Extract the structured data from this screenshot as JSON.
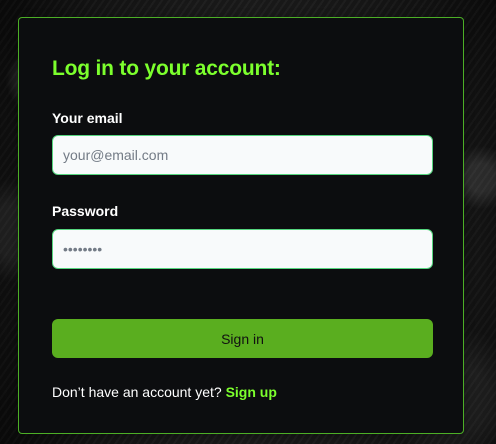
{
  "form": {
    "title": "Log in to your account:",
    "email": {
      "label": "Your email",
      "placeholder": "your@email.com",
      "value": ""
    },
    "password": {
      "label": "Password",
      "placeholder": "••••••••",
      "value": ""
    },
    "submit_label": "Sign in",
    "signup_prompt": "Don’t have an account yet?",
    "signup_link": "Sign up"
  },
  "colors": {
    "accent": "#7cff2d",
    "button": "#5aae1f",
    "card_background": "#0c0d0f",
    "border": "#4caf26"
  }
}
